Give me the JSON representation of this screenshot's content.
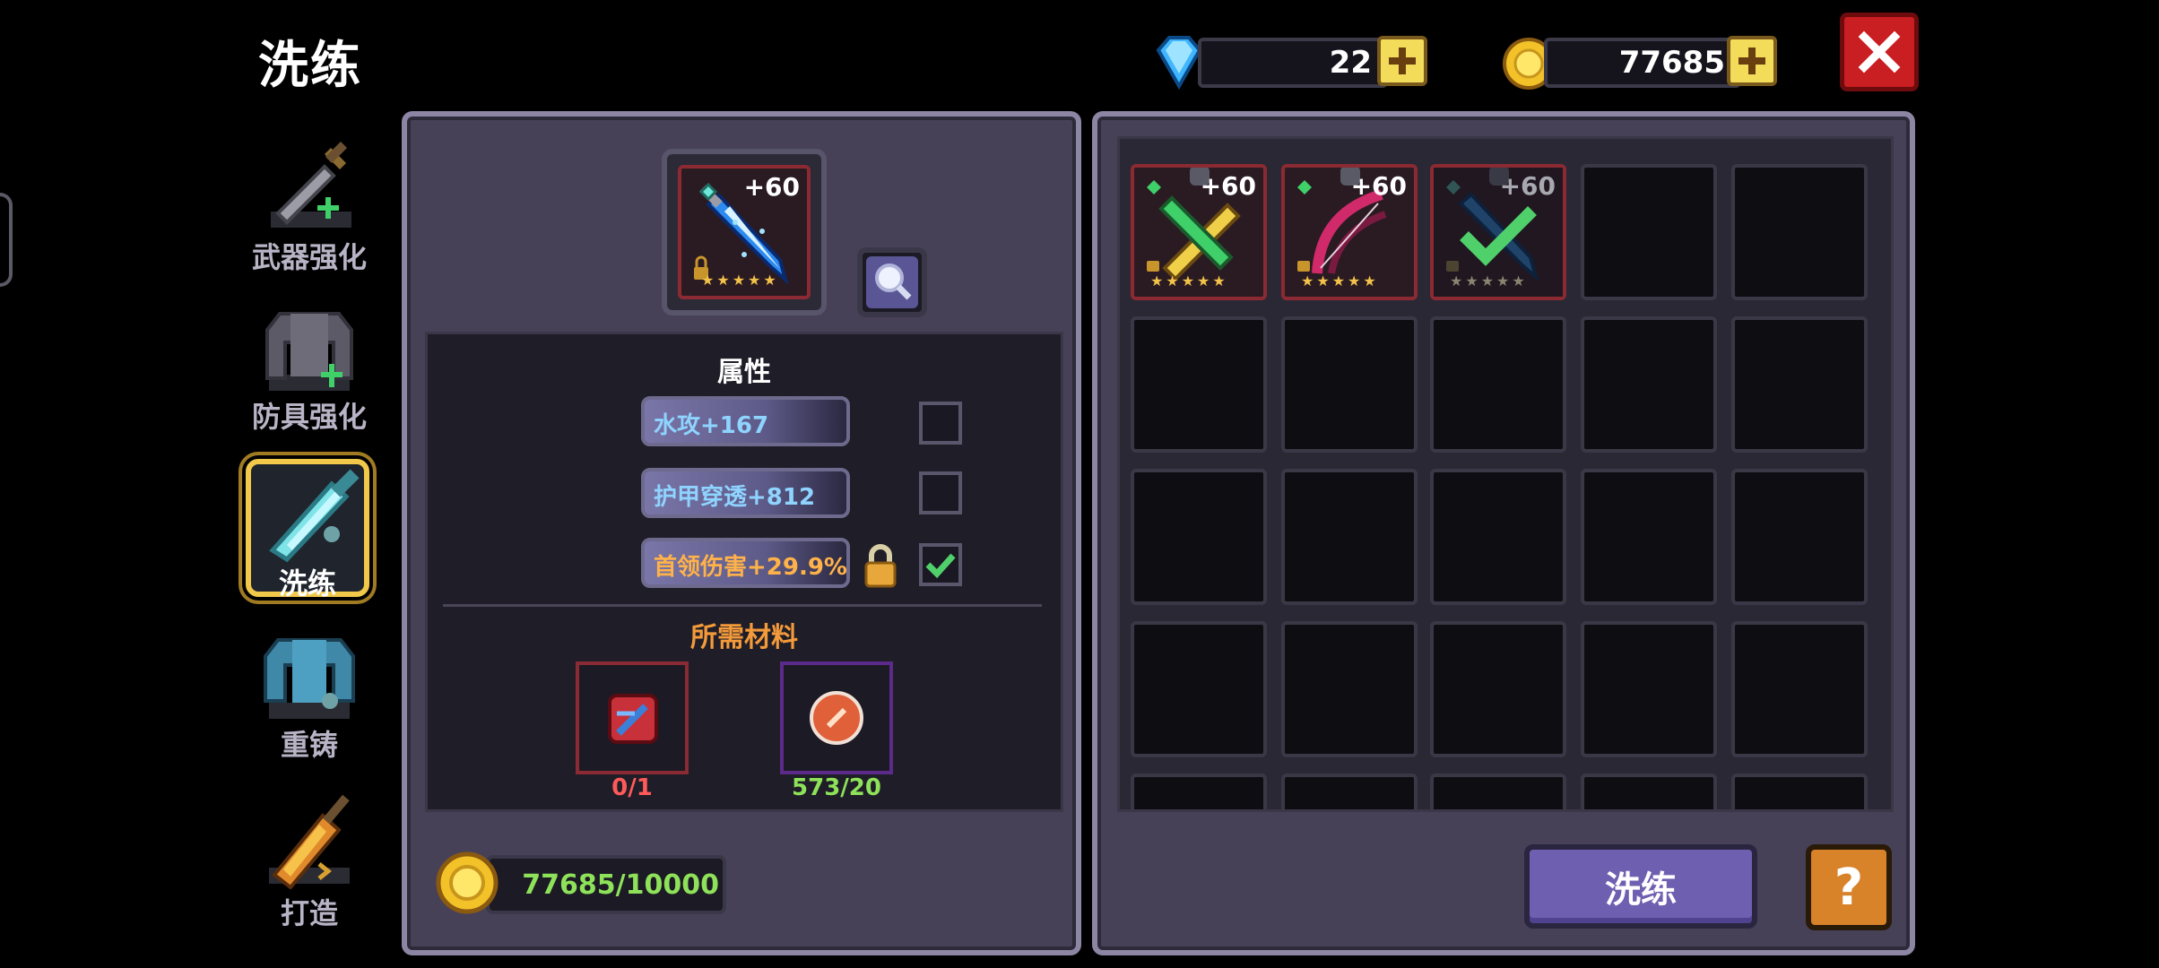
{
  "header": {
    "title": "洗练"
  },
  "currency": {
    "diamonds": "22",
    "gold": "77685"
  },
  "sidebar": {
    "items": [
      {
        "label": "武器强化",
        "icon": "sword-upgrade-icon"
      },
      {
        "label": "防具强化",
        "icon": "armor-upgrade-icon"
      },
      {
        "label": "洗练",
        "icon": "refine-sword-icon",
        "active": true
      },
      {
        "label": "重铸",
        "icon": "recast-armor-icon"
      },
      {
        "label": "打造",
        "icon": "forge-icon"
      }
    ]
  },
  "equipped": {
    "level": "+60",
    "stars": "★★★★★"
  },
  "attributes": {
    "heading": "属性",
    "rows": [
      {
        "text": "水攻+167",
        "locked": false,
        "checked": false
      },
      {
        "text": "护甲穿透+812",
        "locked": false,
        "checked": false
      },
      {
        "text": "首领伤害+29.9%",
        "locked": true,
        "checked": true
      }
    ]
  },
  "materials": {
    "heading": "所需材料",
    "items": [
      {
        "count": "0/1",
        "color": "#ff5a5a"
      },
      {
        "count": "573/20",
        "color": "#8ee25a"
      }
    ]
  },
  "cost": {
    "text": "77685/10000",
    "color": "#8ee25a"
  },
  "inventory": {
    "items": [
      {
        "level": "+60",
        "stars": "★★★★★",
        "selected": false
      },
      {
        "level": "+60",
        "stars": "★★★★★",
        "selected": false
      },
      {
        "level": "+60",
        "stars": "★★★★★",
        "selected": true
      }
    ]
  },
  "actions": {
    "refine_label": "洗练",
    "help_label": "?"
  },
  "colors": {
    "panel": "#474158",
    "accent_gold": "#f2c84a",
    "close_red": "#c91e22",
    "button_purple": "#6f5fb0",
    "help_orange": "#d8822a"
  }
}
